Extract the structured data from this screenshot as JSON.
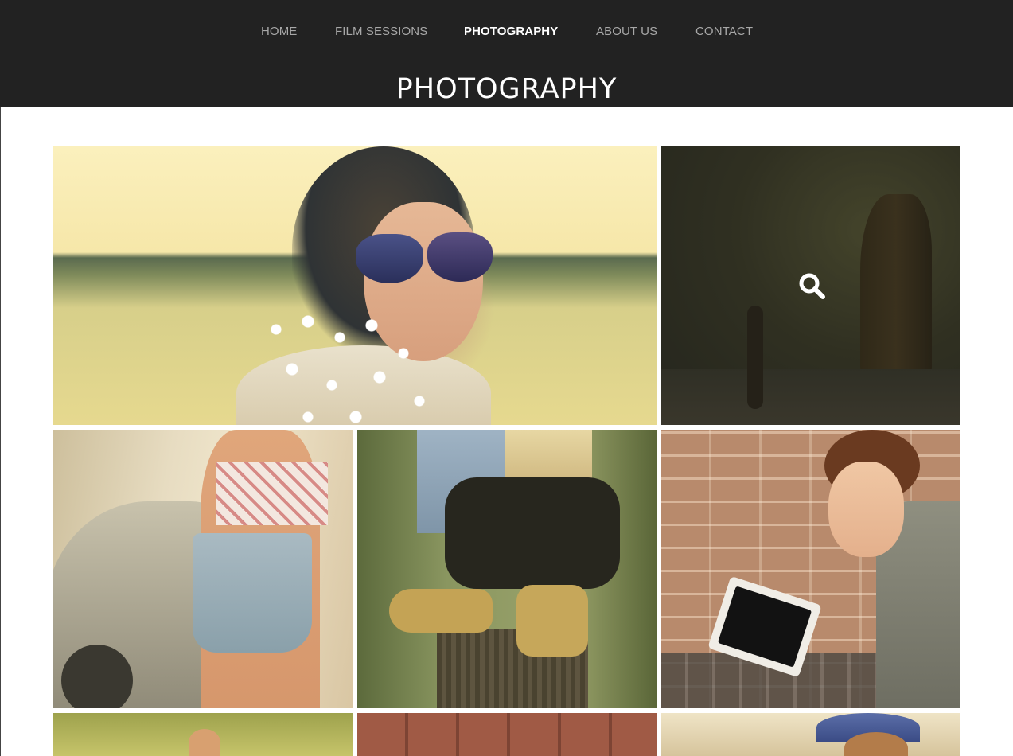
{
  "nav": {
    "items": [
      {
        "label": "HOME",
        "active": false
      },
      {
        "label": "FILM SESSIONS",
        "active": false
      },
      {
        "label": "PHOTOGRAPHY",
        "active": true
      },
      {
        "label": "ABOUT US",
        "active": false
      },
      {
        "label": "CONTACT",
        "active": false
      }
    ]
  },
  "page": {
    "title": "PHOTOGRAPHY"
  },
  "gallery": {
    "hover_icon": "search-icon",
    "photos": [
      "woman-sunglasses-flowers-photo",
      "forest-tree-walker-photo",
      "girl-by-car-photo",
      "girl-boots-on-stump-photo",
      "woman-with-tablet-photo",
      "garden-hand-photo",
      "red-wood-planks-photo",
      "child-with-crown-photo"
    ]
  },
  "colors": {
    "header_bg": "#222222",
    "nav_text": "#a8a8a8",
    "nav_active": "#ffffff",
    "page_bg": "#ffffff"
  }
}
